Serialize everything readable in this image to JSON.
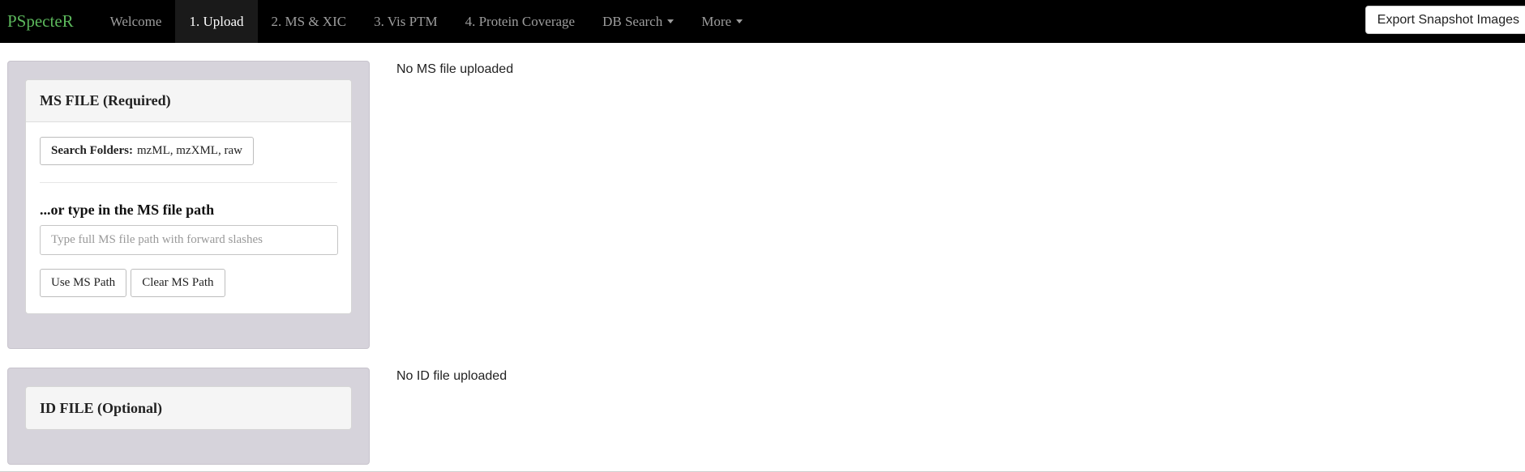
{
  "navbar": {
    "brand": "PSpecteR",
    "items": [
      {
        "label": "Welcome"
      },
      {
        "label": "1. Upload"
      },
      {
        "label": "2. MS & XIC"
      },
      {
        "label": "3. Vis PTM"
      },
      {
        "label": "4. Protein Coverage"
      },
      {
        "label": "DB Search"
      },
      {
        "label": "More"
      }
    ],
    "export_label": "Export Snapshot Images"
  },
  "ms_panel": {
    "title": "MS FILE (Required)",
    "search_label_bold": "Search Folders:",
    "search_label_rest": "mzML, mzXML, raw",
    "subhead": "...or type in the MS file path",
    "input_value": "",
    "input_placeholder": "Type full MS file path with forward slashes",
    "use_label": "Use MS Path",
    "clear_label": "Clear MS Path",
    "status": "No MS file uploaded"
  },
  "id_panel": {
    "title": "ID FILE (Optional)",
    "status": "No ID file uploaded"
  },
  "colors": {
    "navbar_bg": "#000000",
    "brand": "#5cb85c",
    "nav_text": "#9d9d9d",
    "well_bg": "#d6d3db"
  }
}
